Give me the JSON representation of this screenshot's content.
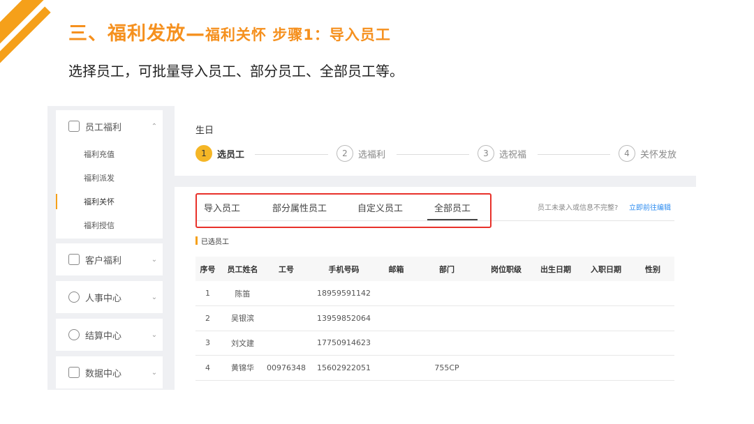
{
  "slide": {
    "title": "三、福利发放—",
    "title_sub": "福利关怀 步骤1：导入员工",
    "description": "选择员工，可批量导入员工、部分员工、全部员工等。"
  },
  "sidebar": {
    "groups": [
      {
        "label": "员工福利",
        "icon": "gift-icon",
        "expanded": true,
        "items": [
          {
            "label": "福利充值"
          },
          {
            "label": "福利派发"
          },
          {
            "label": "福利关怀",
            "active": true
          },
          {
            "label": "福利授信"
          }
        ]
      },
      {
        "label": "客户福利",
        "icon": "customers-icon"
      },
      {
        "label": "人事中心",
        "icon": "person-icon"
      },
      {
        "label": "结算中心",
        "icon": "coin-icon"
      },
      {
        "label": "数据中心",
        "icon": "chart-icon"
      }
    ]
  },
  "page": {
    "name": "生日"
  },
  "steps": [
    {
      "num": "1",
      "label": "选员工",
      "active": true
    },
    {
      "num": "2",
      "label": "选福利"
    },
    {
      "num": "3",
      "label": "选祝福"
    },
    {
      "num": "4",
      "label": "关怀发放"
    }
  ],
  "tabs": [
    {
      "label": "导入员工"
    },
    {
      "label": "部分属性员工"
    },
    {
      "label": "自定义员工"
    },
    {
      "label": "全部员工",
      "active": true
    }
  ],
  "hint": {
    "text": "员工未录入或信息不完整?",
    "link": "立即前往编辑"
  },
  "selected_label": "已选员工",
  "table": {
    "headers": [
      "序号",
      "员工姓名",
      "工号",
      "手机号码",
      "邮箱",
      "部门",
      "岗位职级",
      "出生日期",
      "入职日期",
      "性别"
    ],
    "rows": [
      [
        "1",
        "陈笛",
        "",
        "18959591142",
        "",
        "",
        "",
        "",
        "",
        ""
      ],
      [
        "2",
        "吴银滨",
        "",
        "13959852064",
        "",
        "",
        "",
        "",
        "",
        ""
      ],
      [
        "3",
        "刘文建",
        "",
        "17750914623",
        "",
        "",
        "",
        "",
        "",
        ""
      ],
      [
        "4",
        "黄锦华",
        "00976348",
        "15602922051",
        "",
        "755CP",
        "",
        "",
        "",
        ""
      ]
    ]
  },
  "colors": {
    "accent": "#f5a01a",
    "title": "#f5901e",
    "highlight_box": "#e8312a",
    "link": "#2d8cf0"
  }
}
